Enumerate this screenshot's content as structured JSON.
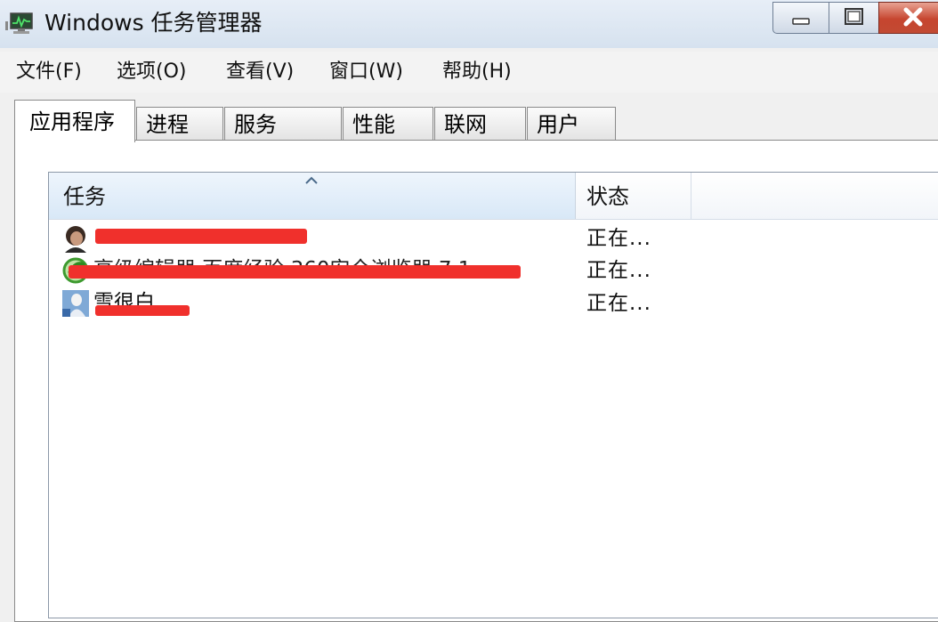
{
  "window": {
    "title": "Windows 任务管理器",
    "icon": "task-manager-monitor-icon"
  },
  "menu": [
    {
      "label": "文件(F)"
    },
    {
      "label": "选项(O)"
    },
    {
      "label": "查看(V)"
    },
    {
      "label": "窗口(W)"
    },
    {
      "label": "帮助(H)"
    }
  ],
  "tabs": [
    {
      "label": "应用程序",
      "active": true
    },
    {
      "label": "进程"
    },
    {
      "label": "服务"
    },
    {
      "label": "性能"
    },
    {
      "label": "联网"
    },
    {
      "label": "用户"
    }
  ],
  "list": {
    "columns": {
      "task": "任务",
      "status": "状态"
    },
    "sort": "ascending",
    "rows": [
      {
        "name": "",
        "status": "正在...",
        "icon": "user-avatar-icon"
      },
      {
        "name": "高级编辑器 百度经验 360安全浏览器 7.1",
        "status": "正在...",
        "icon": "browser-icon"
      },
      {
        "name": "雪很白",
        "status": "正在...",
        "icon": "qq-chat-icon"
      }
    ]
  },
  "colors": {
    "redaction": "#f0302c",
    "header_selected": "#d8e8f7",
    "close_button": "#c6452f"
  }
}
